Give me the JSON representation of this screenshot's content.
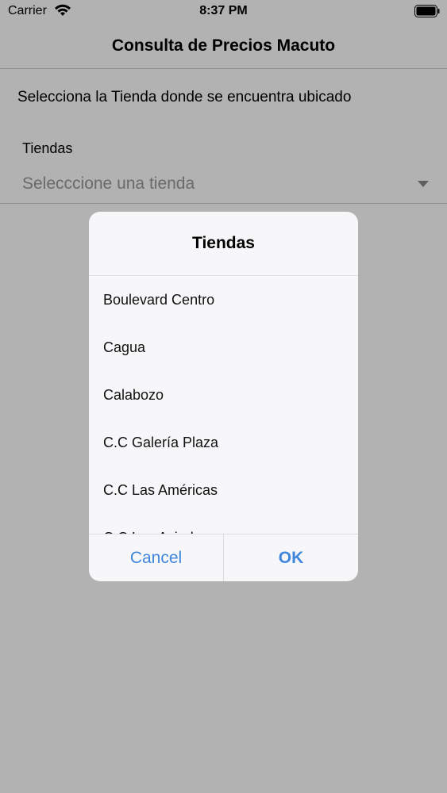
{
  "status_bar": {
    "carrier": "Carrier",
    "time": "8:37 PM"
  },
  "nav": {
    "title": "Consulta de Precios Macuto"
  },
  "form": {
    "instruction": "Selecciona la Tienda donde se encuentra ubicado",
    "field_label": "Tiendas",
    "picker_placeholder": "Selecccione una tienda"
  },
  "dialog": {
    "title": "Tiendas",
    "items": [
      "Boulevard Centro",
      "Cagua",
      "Calabozo",
      "C.C Galería Plaza",
      "C.C Las Américas",
      "C.C Los Aviadores"
    ],
    "cancel_label": "Cancel",
    "ok_label": "OK"
  },
  "colors": {
    "accent": "#3f86dc",
    "overlay": "rgba(0,0,0,0.30)"
  }
}
